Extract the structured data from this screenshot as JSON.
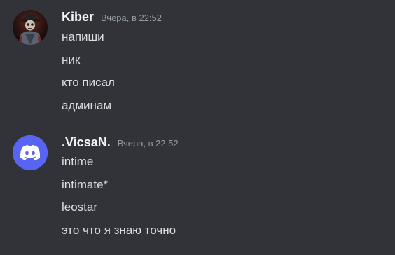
{
  "messages": [
    {
      "author": "Kiber",
      "timestamp": "Вчера, в 22:52",
      "avatar": "dark-rider-avatar",
      "lines": [
        "напиши",
        "ник",
        "кто писал",
        "админам"
      ]
    },
    {
      "author": ".VicsaN.",
      "timestamp": "Вчера, в 22:52",
      "avatar": "discord-default-avatar",
      "avatar_color": "#5865f2",
      "lines": [
        "intime",
        "intimate*",
        "leostar",
        "это что я знаю точно"
      ]
    }
  ],
  "colors": {
    "background": "#313338",
    "username": "#f2f3f5",
    "timestamp": "#949ba4",
    "message_text": "#dbdee1"
  }
}
